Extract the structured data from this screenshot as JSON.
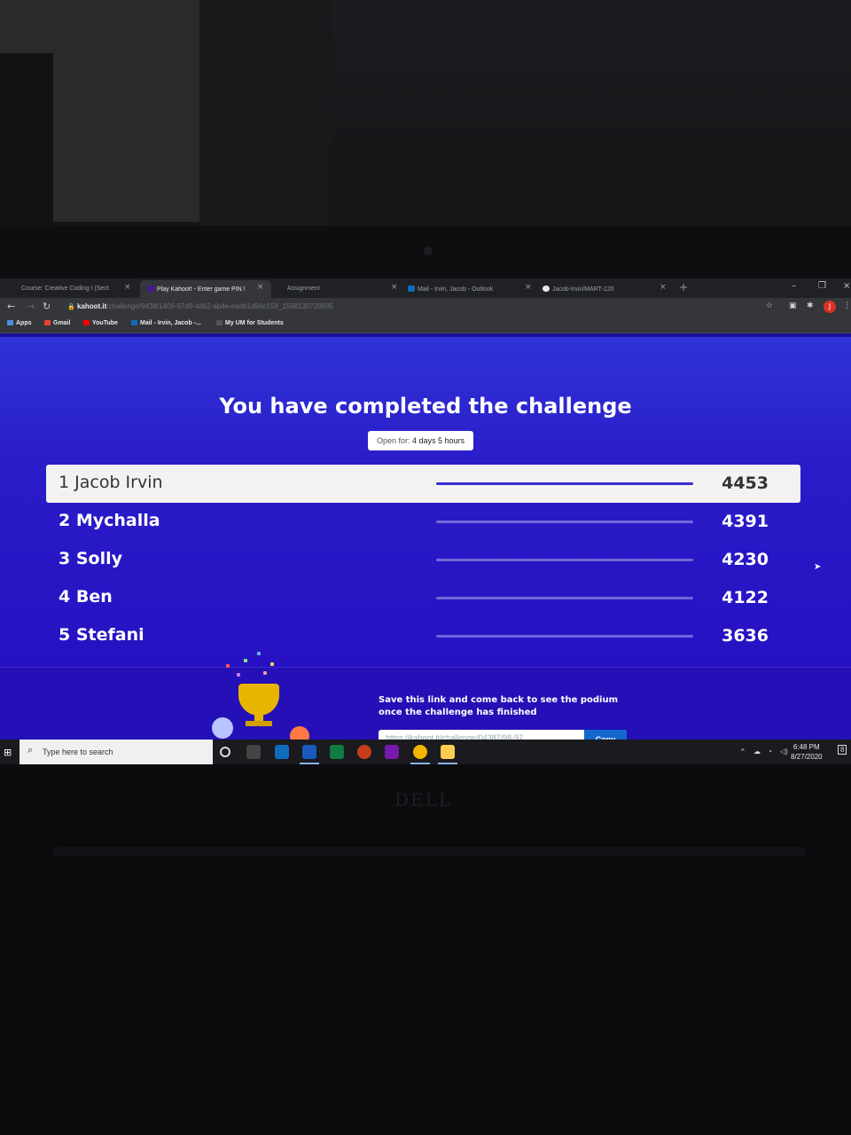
{
  "browser": {
    "tabs": [
      {
        "label": "Course: Creative Coding I (Sect",
        "active": false
      },
      {
        "label": "Play Kahoot! - Enter game PIN !",
        "active": true
      },
      {
        "label": "Assignment",
        "active": false
      },
      {
        "label": "Mail - Irvin, Jacob - Outlook",
        "active": false
      },
      {
        "label": "Jacob-Irvin/MART-120",
        "active": false
      }
    ],
    "url_host": "kahoot.it",
    "url_path": "/challenge/9438/1406-97d9-4d62-ab4e-eadb1d94c158_1598130729695",
    "profile_initial": "J",
    "bookmarks": [
      {
        "label": "Apps"
      },
      {
        "label": "Gmail"
      },
      {
        "label": "YouTube"
      },
      {
        "label": "Mail - Irvin, Jacob -..."
      },
      {
        "label": "My UM for Students"
      }
    ]
  },
  "page": {
    "heading": "You have completed the challenge",
    "open_for_label": "Open for:",
    "open_for_value": "4 days 5 hours",
    "leaderboard": [
      {
        "rank_name": "1 Jacob Irvin",
        "score": "4453",
        "bar_fraction": 1.0
      },
      {
        "rank_name": "2 Mychalla",
        "score": "4391",
        "bar_fraction": 0.0
      },
      {
        "rank_name": "3 Solly",
        "score": "4230",
        "bar_fraction": 0.0
      },
      {
        "rank_name": "4 Ben",
        "score": "4122",
        "bar_fraction": 0.0
      },
      {
        "rank_name": "5 Stefani",
        "score": "3636",
        "bar_fraction": 0.0
      }
    ],
    "save_text": "Save this link and come back to see the podium once the challenge has finished",
    "share_link": "https://kahoot.it/challenge/04387/98-97...",
    "copy_label": "Copy"
  },
  "taskbar": {
    "search_placeholder": "Type here to search",
    "time": "6:48 PM",
    "date": "8/27/2020",
    "notification_count": "8"
  },
  "device": {
    "brand": "DELL"
  },
  "colors": {
    "kahoot_purple": "#2a1cc8",
    "copy_blue": "#1368ce",
    "trophy_gold": "#e8b400"
  }
}
